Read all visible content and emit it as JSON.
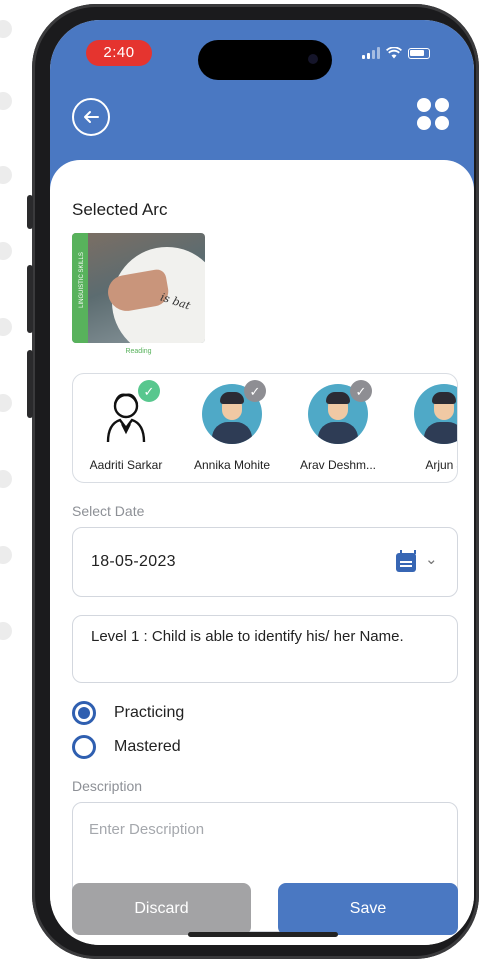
{
  "status_bar": {
    "time": "2:40"
  },
  "header": {
    "back_icon": "back-arrow-circle-icon",
    "menu_icon": "grid-dots-icon",
    "color": "#4a78c2"
  },
  "arc": {
    "title": "Selected Arc",
    "strip_label": "LINGUISTIC SKILLS",
    "image_text": "is bat",
    "caption": "Reading"
  },
  "students": [
    {
      "name": "Aadriti  Sarkar",
      "selected": true,
      "badge_color": "#58c78e",
      "avatar": "outline-person"
    },
    {
      "name": "Annika Mohite",
      "selected": false,
      "badge_color": "#8e8e93",
      "avatar": "boy"
    },
    {
      "name": "Arav Deshm...",
      "selected": false,
      "badge_color": "#8e8e93",
      "avatar": "boy"
    },
    {
      "name": "Arjun J",
      "selected": false,
      "badge_color": "#8e8e93",
      "avatar": "boy"
    }
  ],
  "date": {
    "label": "Select Date",
    "value": "18-05-2023"
  },
  "level": {
    "text": "Level 1 : Child is able to identify his/ her Name."
  },
  "status_options": [
    {
      "label": "Practicing",
      "selected": true
    },
    {
      "label": "Mastered",
      "selected": false
    }
  ],
  "description": {
    "label": "Description",
    "placeholder": "Enter Description",
    "value": ""
  },
  "actions": {
    "discard": "Discard",
    "save": "Save"
  },
  "colors": {
    "primary": "#4a78c2",
    "radio": "#2f5fb0",
    "discard": "#a3a3a5",
    "check_green": "#58c78e"
  }
}
